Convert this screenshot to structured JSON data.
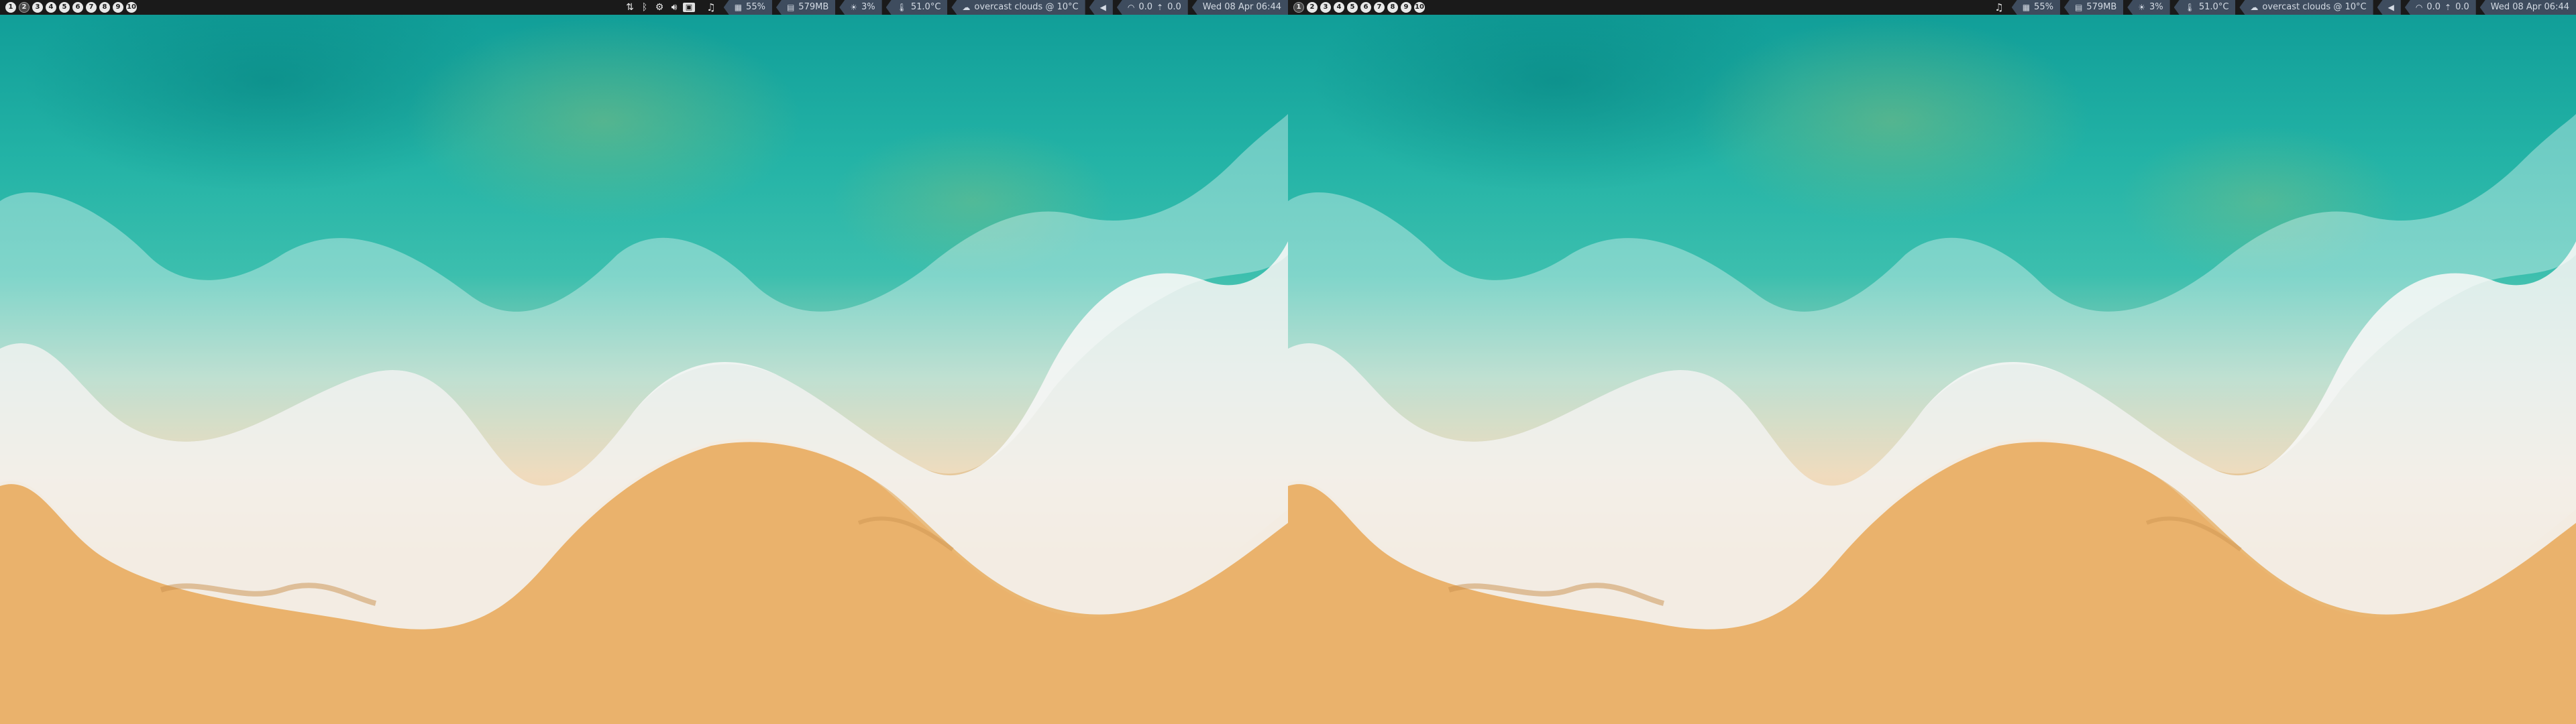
{
  "screens": [
    {
      "workspaces": [
        "1",
        "2",
        "3",
        "4",
        "5",
        "6",
        "7",
        "8",
        "9",
        "10"
      ],
      "active_workspace": 1,
      "tray_icons": [
        "network-transfer-icon",
        "bluetooth-icon",
        "gear-icon",
        "volume-icon",
        "window-icon"
      ],
      "music_icon": "music-note-icon",
      "modules": {
        "cpu": {
          "icon": "cpu-icon",
          "value": "55%"
        },
        "memory": {
          "icon": "memory-icon",
          "value": "579MB"
        },
        "brightness": {
          "icon": "brightness-icon",
          "value": "3%"
        },
        "temperature": {
          "icon": "thermometer-icon",
          "value": "51.0°C"
        },
        "weather": {
          "icon": "cloud-icon",
          "value": "overcast clouds @ 10°C"
        },
        "volume": {
          "icon": "volume-icon",
          "value": ""
        },
        "network": {
          "icon": "wifi-icon",
          "down": "0.0",
          "up": "0.0"
        },
        "clock": {
          "value": "Wed 08 Apr 06:44"
        }
      }
    },
    {
      "workspaces": [
        "1",
        "2",
        "3",
        "4",
        "5",
        "6",
        "7",
        "8",
        "9",
        "10"
      ],
      "active_workspace": 0,
      "tray_icons": [],
      "music_icon": "music-note-icon",
      "modules": {
        "cpu": {
          "icon": "cpu-icon",
          "value": "55%"
        },
        "memory": {
          "icon": "memory-icon",
          "value": "579MB"
        },
        "brightness": {
          "icon": "brightness-icon",
          "value": "3%"
        },
        "temperature": {
          "icon": "thermometer-icon",
          "value": "51.0°C"
        },
        "weather": {
          "icon": "cloud-icon",
          "value": "overcast clouds @ 10°C"
        },
        "volume": {
          "icon": "volume-icon",
          "value": ""
        },
        "network": {
          "icon": "wifi-icon",
          "down": "0.0",
          "up": "0.0"
        },
        "clock": {
          "value": "Wed 08 Apr 06:44"
        }
      }
    }
  ],
  "colors": {
    "bar_bg": "#1a1a1a",
    "module_bg": "#3e4c5e",
    "module_fg": "#d4dbe4",
    "sea": "#23b3a6",
    "sand": "#eab26c"
  }
}
